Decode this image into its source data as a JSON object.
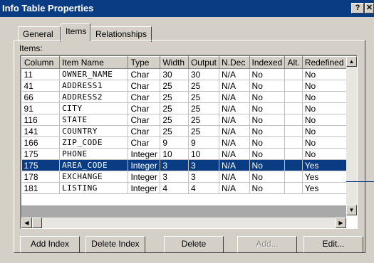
{
  "window": {
    "title": "Info Table Properties",
    "help_button": "?",
    "close_button": "✕"
  },
  "tabs": [
    "General",
    "Items",
    "Relationships"
  ],
  "active_tab": "Items",
  "items_label": "Items:",
  "columns": [
    "Column",
    "Item Name",
    "Type",
    "Width",
    "Output",
    "N.Dec",
    "Indexed",
    "Alt.",
    "Redefined"
  ],
  "rows": [
    [
      "11",
      "OWNER_NAME",
      "Char",
      "30",
      "30",
      "N/A",
      "No",
      "",
      "No"
    ],
    [
      "41",
      "ADDRESS1",
      "Char",
      "25",
      "25",
      "N/A",
      "No",
      "",
      "No"
    ],
    [
      "66",
      "ADDRESS2",
      "Char",
      "25",
      "25",
      "N/A",
      "No",
      "",
      "No"
    ],
    [
      "91",
      "CITY",
      "Char",
      "25",
      "25",
      "N/A",
      "No",
      "",
      "No"
    ],
    [
      "116",
      "STATE",
      "Char",
      "25",
      "25",
      "N/A",
      "No",
      "",
      "No"
    ],
    [
      "141",
      "COUNTRY",
      "Char",
      "25",
      "25",
      "N/A",
      "No",
      "",
      "No"
    ],
    [
      "166",
      "ZIP_CODE",
      "Char",
      "9",
      "9",
      "N/A",
      "No",
      "",
      "No"
    ],
    [
      "175",
      "PHONE",
      "Integer",
      "10",
      "10",
      "N/A",
      "No",
      "",
      "No"
    ],
    [
      "175",
      "AREA_CODE",
      "Integer",
      "3",
      "3",
      "N/A",
      "No",
      "",
      "Yes"
    ],
    [
      "178",
      "EXCHANGE",
      "Integer",
      "3",
      "3",
      "N/A",
      "No",
      "",
      "Yes"
    ],
    [
      "181",
      "LISTING",
      "Integer",
      "4",
      "4",
      "N/A",
      "No",
      "",
      "Yes"
    ]
  ],
  "selected_row": 8,
  "buttons": {
    "add_index": "Add Index",
    "delete_index": "Delete Index",
    "delete": "Delete",
    "add": "Add...",
    "edit": "Edit..."
  },
  "scroll": {
    "up": "▲",
    "down": "▼",
    "left": "◀",
    "right": "▶"
  },
  "colors": {
    "title_bar": "#0a3c83",
    "selection": "#0a3c83",
    "dialog_face": "#d4d0c8"
  }
}
